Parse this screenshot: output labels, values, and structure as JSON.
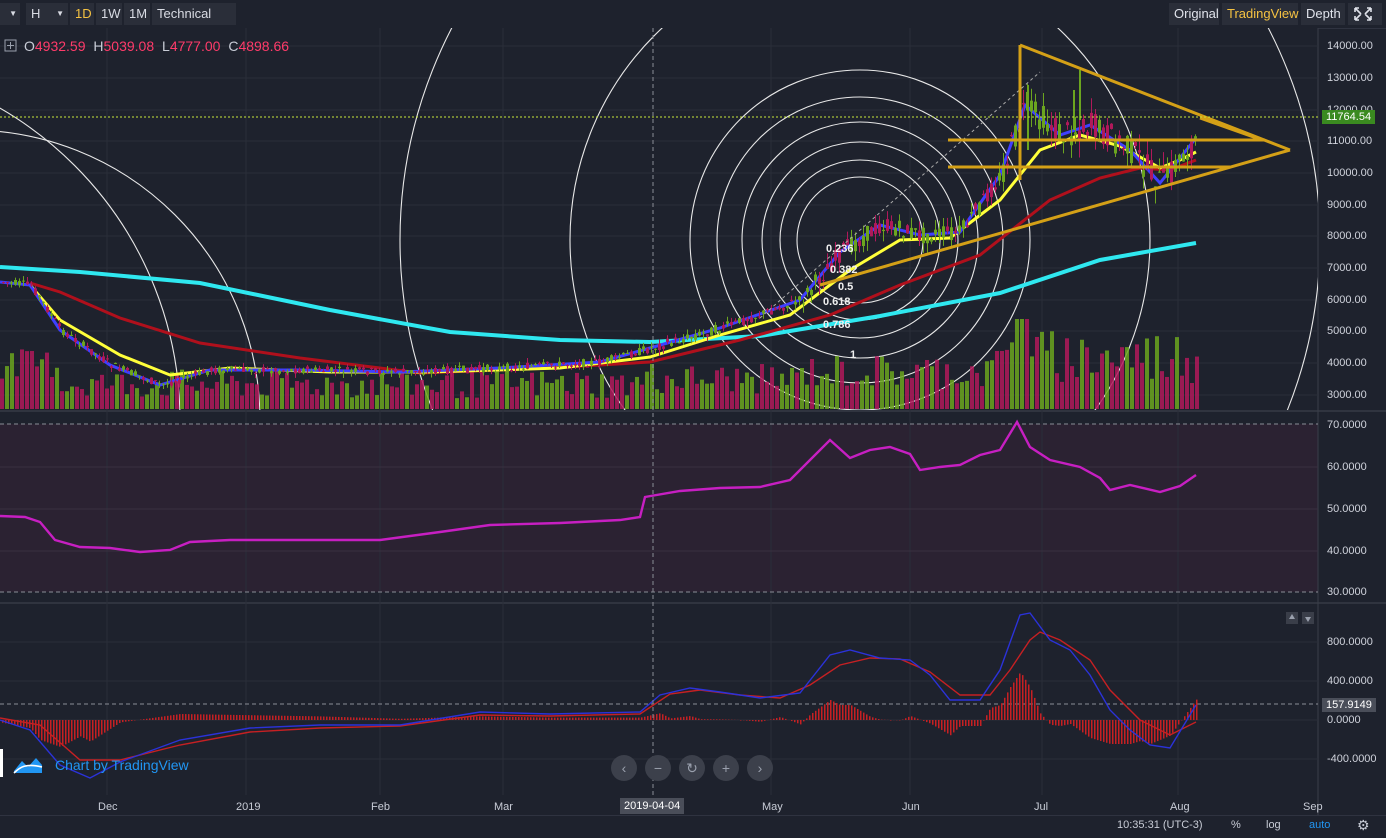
{
  "toolbar": {
    "first_dropdown": "",
    "resolution": "H",
    "intervals": [
      {
        "label": "1D",
        "active": true
      },
      {
        "label": "1W",
        "active": false
      },
      {
        "label": "1M",
        "active": false
      }
    ],
    "technical_label": "Technical Ind",
    "views": [
      {
        "label": "Original",
        "active": false
      },
      {
        "label": "TradingView",
        "active": true
      },
      {
        "label": "Depth",
        "active": false
      }
    ],
    "fullscreen_icon": "expand-icon"
  },
  "ohlc": {
    "o_key": "O",
    "o": "4932.59",
    "h_key": "H",
    "h": "5039.08",
    "l_key": "L",
    "l": "4777.00",
    "c_key": "C",
    "c": "4898.66"
  },
  "price_axis": [
    "14000.00",
    "13000.00",
    "12000.00",
    "11000.00",
    "10000.00",
    "9000.00",
    "8000.00",
    "7000.00",
    "6000.00",
    "5000.00",
    "4000.00",
    "3000.00"
  ],
  "last_price": "11764.54",
  "rsi_axis": [
    "70.0000",
    "60.0000",
    "50.0000",
    "40.0000",
    "30.0000"
  ],
  "macd_axis": [
    "800.0000",
    "400.0000",
    "0.0000",
    "-400.0000"
  ],
  "macd_value": "157.9149",
  "fib_labels": [
    "0.236",
    "0.382",
    "0.5",
    "0.618",
    "0.786",
    "1"
  ],
  "time_axis": [
    "Dec",
    "2019",
    "Feb",
    "Mar",
    "May",
    "Jun",
    "Jul",
    "Aug",
    "Sep"
  ],
  "crosshair_date": "2019-04-04",
  "logo_text": "Chart by TradingView",
  "nav_buttons": [
    "‹",
    "−",
    "↻",
    "+",
    "›"
  ],
  "status": {
    "clock": "10:35:31 (UTC-3)",
    "percent": "%",
    "log": "log",
    "auto": "auto",
    "settings_icon": "gear-icon"
  },
  "colors": {
    "up": "#6ba51f",
    "down": "#b0195a",
    "rsi": "#c71fc2",
    "macd": "#2b32d9",
    "signal": "#c62023",
    "accent": "#f5c242",
    "ema_fast": "#3f3fff",
    "ema_yellow": "#ffff3a",
    "ema_red": "#b0101c",
    "ema_cyan": "#2fe8f0",
    "trend": "#d4a017"
  }
}
